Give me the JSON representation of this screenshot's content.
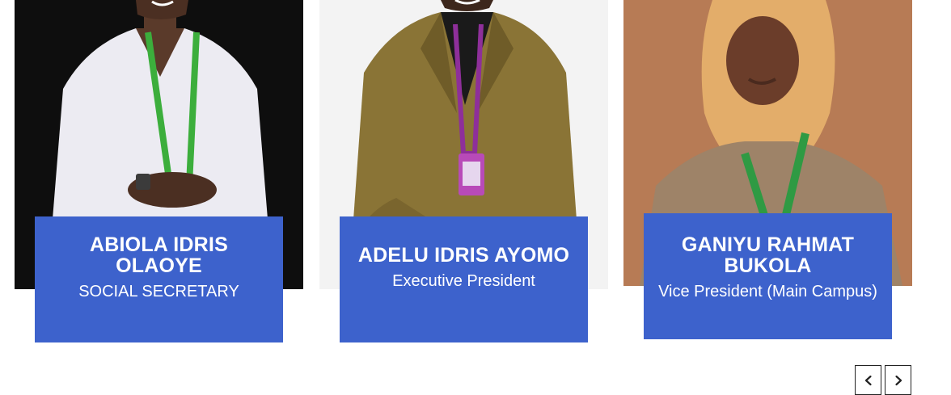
{
  "team": [
    {
      "name": "ABIOLA IDRIS OLAOYE",
      "role": "SOCIAL SECRETARY",
      "photo_icon": "person-photo-icon"
    },
    {
      "name": "ADELU IDRIS AYOMO",
      "role": "Executive President",
      "photo_icon": "person-photo-icon"
    },
    {
      "name": "GANIYU RAHMAT BUKOLA",
      "role": "Vice President (Main Campus)",
      "photo_icon": "person-photo-icon"
    }
  ],
  "navigation": {
    "prev_icon": "chevron-left-icon",
    "next_icon": "chevron-right-icon"
  },
  "colors": {
    "card_accent": "#3d62cc",
    "photo1_bg": "#111111",
    "photo2_bg": "#f2f2f2",
    "photo3_bg": "#b77b55"
  }
}
